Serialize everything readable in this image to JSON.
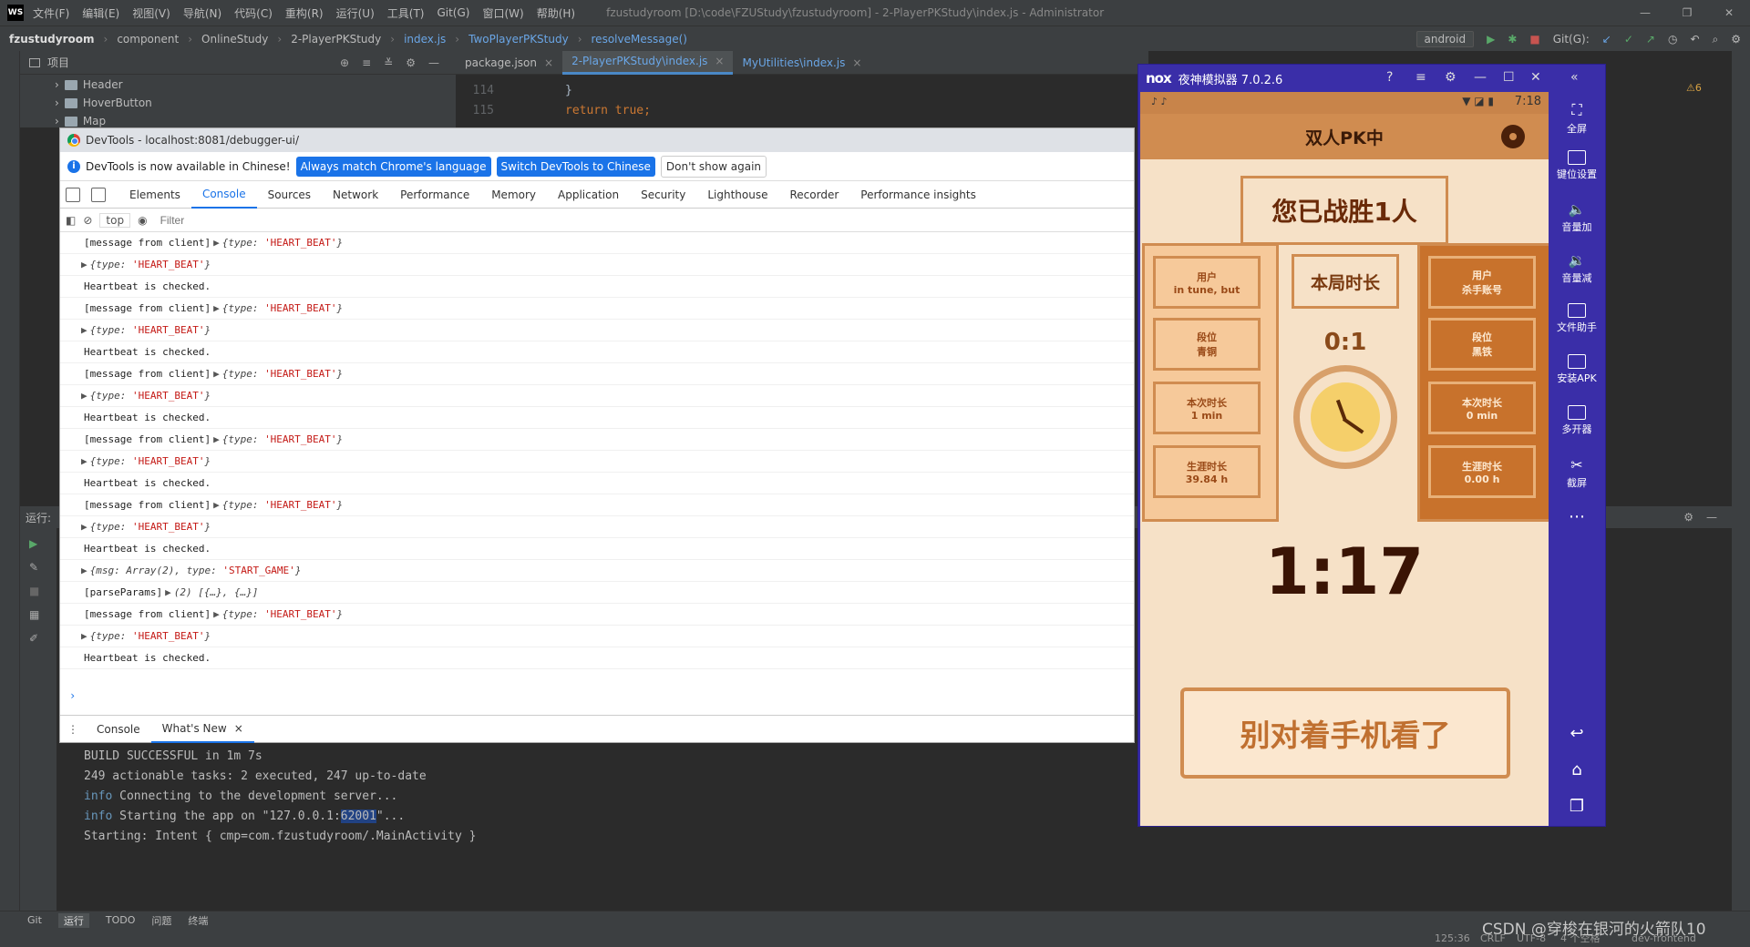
{
  "ide": {
    "app_logo": "WS",
    "menu": [
      "文件(F)",
      "编辑(E)",
      "视图(V)",
      "导航(N)",
      "代码(C)",
      "重构(R)",
      "运行(U)",
      "工具(T)",
      "Git(G)",
      "窗口(W)",
      "帮助(H)"
    ],
    "window_title": "fzustudyroom [D:\\code\\FZUStudy\\fzustudyroom] - 2-PlayerPKStudy\\index.js - Administrator",
    "breadcrumbs": [
      "fzustudyroom",
      "component",
      "OnlineStudy",
      "2-PlayerPKStudy",
      "index.js",
      "TwoPlayerPKStudy",
      "resolveMessage()"
    ],
    "run_config": "android",
    "git_label": "Git(G):",
    "project_label": "项目",
    "tree": [
      "Header",
      "HoverButton",
      "Map"
    ],
    "editor_tabs": [
      "package.json",
      "2-PlayerPKStudy\\index.js",
      "MyUtilities\\index.js"
    ],
    "editor_lines": [
      {
        "num": "114",
        "code": "}"
      },
      {
        "num": "115",
        "code": "return true;"
      }
    ],
    "warnings_badge": "⚠6",
    "run_label": "运行:",
    "run_log": [
      {
        "text": "BUILD SUCCESSFUL in 1m 7s",
        "kind": "plain"
      },
      {
        "text": "249 actionable tasks: 2 executed, 247 up-to-date",
        "kind": "plain"
      },
      {
        "prefix": "info",
        "text": " Connecting to the development server...",
        "kind": "info"
      },
      {
        "prefix": "info",
        "text": " Starting the app on \"127.0.0.1:",
        "highlight": "62001",
        "suffix": "\"...",
        "kind": "info-hl"
      },
      {
        "text": "Starting: Intent { cmp=com.fzustudyroom/.MainActivity }",
        "kind": "plain"
      }
    ],
    "bottom_tabs": [
      "Git",
      "运行",
      "TODO",
      "问题",
      "终端"
    ],
    "status": {
      "position": "125:36",
      "line_sep": "CRLF",
      "encoding": "UTF-8",
      "indent": "4 个空格",
      "branch": "dev-frontend"
    },
    "watermark": "CSDN @穿梭在银河的火箭队10"
  },
  "devtools": {
    "title": "DevTools - localhost:8081/debugger-ui/",
    "info_text": "DevTools is now available in Chinese!",
    "btn_match": "Always match Chrome's language",
    "btn_switch": "Switch DevTools to Chinese",
    "btn_dismiss": "Don't show again",
    "tabs": [
      "Elements",
      "Console",
      "Sources",
      "Network",
      "Performance",
      "Memory",
      "Application",
      "Security",
      "Lighthouse",
      "Recorder",
      "Performance insights"
    ],
    "context": "top",
    "filter_placeholder": "Filter",
    "console_lines": [
      {
        "pre": "[message from client]",
        "obj": "{type: ",
        "str": "'HEART_BEAT'",
        "end": "}"
      },
      {
        "pre": "",
        "obj": "{type: ",
        "str": "'HEART_BEAT'",
        "end": "}"
      },
      {
        "pre": "Heartbeat is checked.",
        "obj": "",
        "str": "",
        "end": ""
      },
      {
        "pre": "[message from client]",
        "obj": "{type: ",
        "str": "'HEART_BEAT'",
        "end": "}"
      },
      {
        "pre": "",
        "obj": "{type: ",
        "str": "'HEART_BEAT'",
        "end": "}"
      },
      {
        "pre": "Heartbeat is checked.",
        "obj": "",
        "str": "",
        "end": ""
      },
      {
        "pre": "[message from client]",
        "obj": "{type: ",
        "str": "'HEART_BEAT'",
        "end": "}"
      },
      {
        "pre": "",
        "obj": "{type: ",
        "str": "'HEART_BEAT'",
        "end": "}"
      },
      {
        "pre": "Heartbeat is checked.",
        "obj": "",
        "str": "",
        "end": ""
      },
      {
        "pre": "[message from client]",
        "obj": "{type: ",
        "str": "'HEART_BEAT'",
        "end": "}"
      },
      {
        "pre": "",
        "obj": "{type: ",
        "str": "'HEART_BEAT'",
        "end": "}"
      },
      {
        "pre": "Heartbeat is checked.",
        "obj": "",
        "str": "",
        "end": ""
      },
      {
        "pre": "[message from client]",
        "obj": "{type: ",
        "str": "'HEART_BEAT'",
        "end": "}"
      },
      {
        "pre": "",
        "obj": "{type: ",
        "str": "'HEART_BEAT'",
        "end": "}"
      },
      {
        "pre": "Heartbeat is checked.",
        "obj": "",
        "str": "",
        "end": ""
      },
      {
        "pre": "",
        "obj": "{msg: Array(2), type: ",
        "str": "'START_GAME'",
        "end": "}"
      },
      {
        "pre": "[parseParams]",
        "obj": "(2) [{…}, {…}]",
        "str": "",
        "end": ""
      },
      {
        "pre": "[message from client]",
        "obj": "{type: ",
        "str": "'HEART_BEAT'",
        "end": "}"
      },
      {
        "pre": "",
        "obj": "{type: ",
        "str": "'HEART_BEAT'",
        "end": "}"
      },
      {
        "pre": "Heartbeat is checked.",
        "obj": "",
        "str": "",
        "end": ""
      }
    ],
    "drawer_tabs": [
      "Console",
      "What's New"
    ]
  },
  "nox": {
    "logo": "nox",
    "title": "夜神模拟器 7.0.2.6",
    "side": [
      "全屏",
      "键位设置",
      "音量加",
      "音量减",
      "文件助手",
      "安装APK",
      "多开器",
      "截屏"
    ],
    "phone_time": "7:18",
    "app": {
      "header": "双人PK中",
      "victory": "您已战胜1人",
      "center_title": "本局时长",
      "score": "0:1",
      "timer": "1:17",
      "bottom_btn": "别对着手机看了",
      "left": [
        {
          "label": "用户",
          "value": "in tune, but"
        },
        {
          "label": "段位",
          "value": "青铜"
        },
        {
          "label": "本次时长",
          "value": "1 min"
        },
        {
          "label": "生涯时长",
          "value": "39.84 h"
        }
      ],
      "right": [
        {
          "label": "用户",
          "value": "杀手账号"
        },
        {
          "label": "段位",
          "value": "黑铁"
        },
        {
          "label": "本次时长",
          "value": "0 min"
        },
        {
          "label": "生涯时长",
          "value": "0.00 h"
        }
      ]
    }
  }
}
